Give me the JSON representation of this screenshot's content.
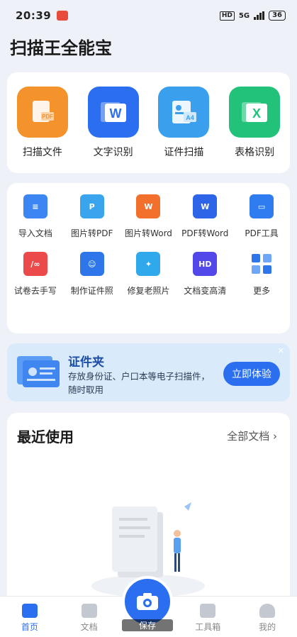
{
  "status": {
    "time": "20:39",
    "battery": "36",
    "network": "5G"
  },
  "app_title": "扫描王全能宝",
  "main_features": [
    {
      "label": "扫描文件",
      "icon": "scan-pdf-icon",
      "glyph": "PDF",
      "color": "#f4932c"
    },
    {
      "label": "文字识别",
      "icon": "word-icon",
      "glyph": "W",
      "color": "#2b6ff0"
    },
    {
      "label": "证件扫描",
      "icon": "id-card-icon",
      "glyph": "A4",
      "color": "#3aa0ee"
    },
    {
      "label": "表格识别",
      "icon": "excel-icon",
      "glyph": "X",
      "color": "#22c27a"
    }
  ],
  "tools": [
    {
      "label": "导入文档",
      "icon": "import-doc-icon",
      "glyph": "≡",
      "color": "#3b86f2"
    },
    {
      "label": "图片转PDF",
      "icon": "image-to-pdf-icon",
      "glyph": "P",
      "color": "#3aa5ee"
    },
    {
      "label": "图片转Word",
      "icon": "image-to-word-icon",
      "glyph": "W",
      "color": "#f2702c"
    },
    {
      "label": "PDF转Word",
      "icon": "pdf-to-word-icon",
      "glyph": "W",
      "color": "#2e64e8"
    },
    {
      "label": "PDF工具",
      "icon": "toolbox-icon",
      "glyph": "▭",
      "color": "#2e7cf0"
    },
    {
      "label": "试卷去手写",
      "icon": "erase-handwriting-icon",
      "glyph": "∕∞",
      "color": "#ec4a4a"
    },
    {
      "label": "制作证件照",
      "icon": "id-photo-icon",
      "glyph": "☺",
      "color": "#2e76ea"
    },
    {
      "label": "修复老照片",
      "icon": "repair-photo-icon",
      "glyph": "✦",
      "color": "#2fa9ec"
    },
    {
      "label": "文档变高清",
      "icon": "hd-doc-icon",
      "glyph": "HD",
      "color": "#5247e8"
    },
    {
      "label": "更多",
      "icon": "more-grid-icon",
      "glyph": "▦",
      "color": "#3b86f2"
    }
  ],
  "banner": {
    "title": "证件夹",
    "desc": "存放身份证、户口本等电子扫描件，随时取用",
    "button": "立即体验"
  },
  "recent": {
    "title": "最近使用",
    "all_docs": "全部文档 ›"
  },
  "bottom_nav": {
    "home": "首页",
    "docs": "文档",
    "camera_label": "保存",
    "toolbox": "工具箱",
    "mine": "我的"
  }
}
